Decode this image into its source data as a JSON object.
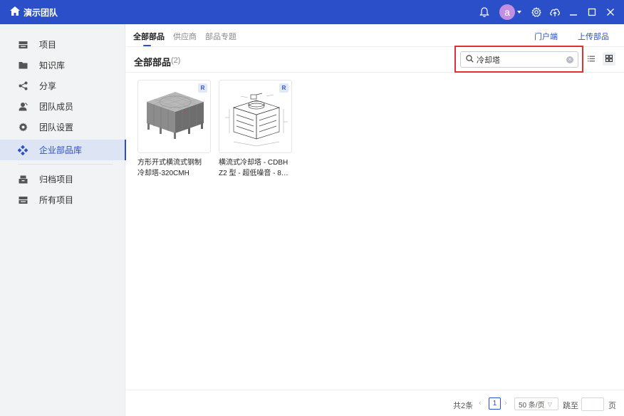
{
  "app": {
    "title": "演示团队",
    "avatar_letter": "a",
    "accent": "#2b4fc8"
  },
  "sidebar": {
    "items": [
      {
        "label": "项目",
        "icon": "project-icon"
      },
      {
        "label": "知识库",
        "icon": "folder-icon"
      },
      {
        "label": "分享",
        "icon": "share-icon"
      },
      {
        "label": "团队成员",
        "icon": "team-members-icon"
      },
      {
        "label": "团队设置",
        "icon": "settings-icon"
      },
      {
        "label": "企业部品库",
        "icon": "parts-library-icon",
        "active": true
      },
      {
        "label": "归档项目",
        "icon": "archive-icon"
      },
      {
        "label": "所有项目",
        "icon": "all-projects-icon"
      }
    ]
  },
  "tabs": {
    "items": [
      "全部部品",
      "供应商",
      "部品专题"
    ],
    "active": "全部部品",
    "links": [
      "门户端",
      "上传部品"
    ]
  },
  "header": {
    "title": "全部部品",
    "count": "(2)"
  },
  "search": {
    "value": "冷却塔",
    "placeholder": ""
  },
  "cards": [
    {
      "badge": "R",
      "name_line1": "方形开式横流式钢制",
      "name_line2": "冷却塔-320CMH"
    },
    {
      "badge": "R",
      "name_line1": "横流式冷却塔 - CDBH",
      "name_line2": "Z2 型 - 超低噪音 - 8…"
    }
  ],
  "pagination": {
    "total": "共2条",
    "current_page": "1",
    "page_size": "50 条/页",
    "jump_label": "跳至",
    "page_unit": "页"
  }
}
